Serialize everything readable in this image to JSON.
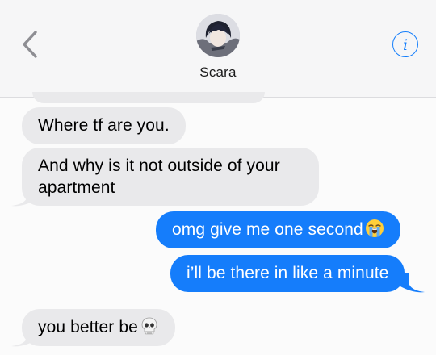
{
  "header": {
    "back_icon": "chevron-left-icon",
    "contact_name": "Scara",
    "info_icon": "info-icon",
    "info_glyph": "i",
    "accent": "#147efb"
  },
  "messages": [
    {
      "direction": "incoming",
      "text": "Where tf are you."
    },
    {
      "direction": "incoming",
      "text": "And why is it not outside of your apartment"
    },
    {
      "direction": "outgoing",
      "text": "omg give me one second",
      "emoji": "loudly-crying-face"
    },
    {
      "direction": "outgoing",
      "text": "i’ll be there in like a minute"
    },
    {
      "direction": "incoming",
      "text": "you better be",
      "emoji": "skull"
    }
  ],
  "colors": {
    "incoming_bubble": "#e9e9eb",
    "outgoing_bubble": "#157dfb",
    "header_bg": "#f6f6f7",
    "background": "#fbfbfb"
  }
}
